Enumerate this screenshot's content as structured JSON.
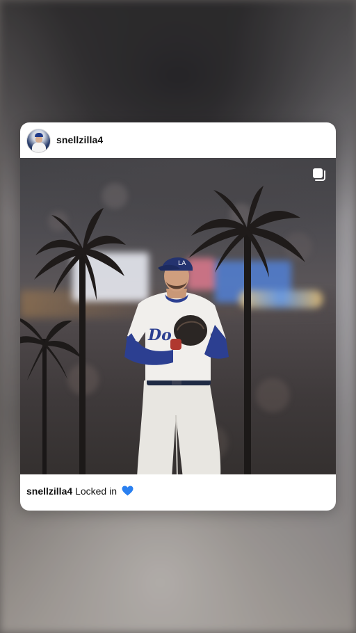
{
  "post": {
    "username": "snellzilla4",
    "caption_user": "snellzilla4",
    "caption_text": "Locked in",
    "caption_emoji_icon": "blue-heart-icon"
  },
  "icons": {
    "carousel": "carousel-icon",
    "avatar": "avatar"
  },
  "colors": {
    "heart": "#2a80f0",
    "card_bg": "#ffffff",
    "text": "#111111"
  }
}
